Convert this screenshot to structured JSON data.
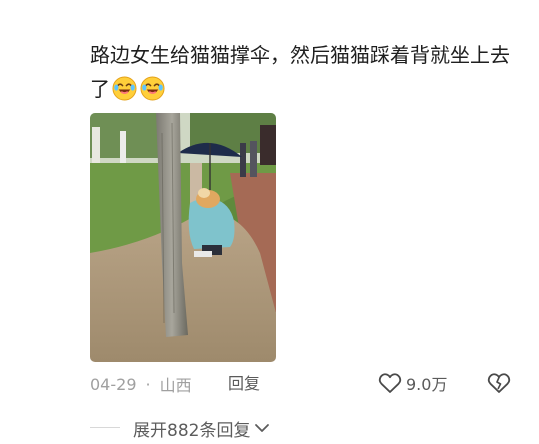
{
  "comment": {
    "text": "路边女生给猫猫撑伞，然后猫猫踩着背就坐上去了",
    "emojis": [
      "laugh-cry-emoji",
      "laugh-cry-emoji"
    ]
  },
  "photo": {
    "description_icon": "image"
  },
  "meta": {
    "date": "04-29",
    "separator": "·",
    "location": "山西",
    "reply_label": "回复"
  },
  "actions": {
    "like_icon": "heart-outline-icon",
    "like_count": "9.0万",
    "dislike_icon": "broken-heart-icon"
  },
  "replies": {
    "expand_label": "展开882条回复",
    "expand_icon": "chevron-down-icon"
  },
  "colors": {
    "text_primary": "#1f1f1f",
    "text_secondary": "#a0a0a0",
    "action_text": "#5a5a5a"
  }
}
